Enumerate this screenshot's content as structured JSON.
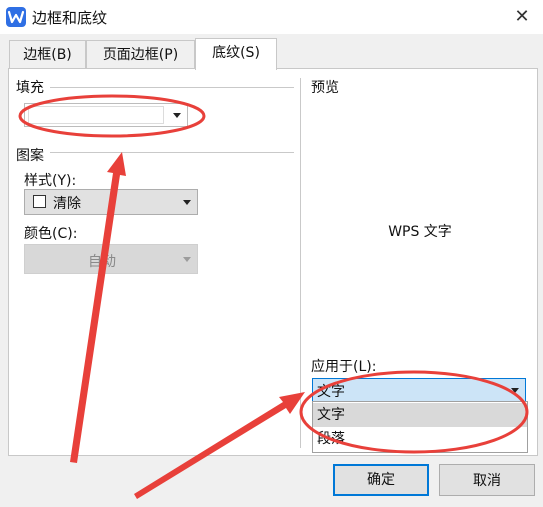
{
  "window": {
    "title": "边框和底纹",
    "app_icon": "wps-writer-icon",
    "close_glyph": "✕"
  },
  "tabs": [
    {
      "label": "边框(B)",
      "active": false
    },
    {
      "label": "页面边框(P)",
      "active": false
    },
    {
      "label": "底纹(S)",
      "active": true
    }
  ],
  "fill": {
    "section_label": "填充",
    "value": ""
  },
  "pattern": {
    "section_label": "图案",
    "style_label": "样式(Y):",
    "style_value": "清除",
    "color_label": "颜色(C):",
    "color_value": "自动"
  },
  "preview": {
    "section_label": "预览",
    "sample_text": "WPS 文字"
  },
  "apply_to": {
    "label": "应用于(L):",
    "value": "文字",
    "options": [
      "文字",
      "段落"
    ],
    "highlighted_option": "文字"
  },
  "buttons": {
    "ok_label": "确定",
    "cancel_label": "取消"
  },
  "annotation": {
    "color": "#e8403a",
    "markers": [
      "fill-dropdown-highlight",
      "apply-dropdown-highlight",
      "arrow-to-fill",
      "arrow-to-apply"
    ]
  },
  "colors": {
    "accent": "#0078d7",
    "dropdown_selected_bg": "#cce4f7",
    "app_icon_blue": "#2f6fe4"
  }
}
